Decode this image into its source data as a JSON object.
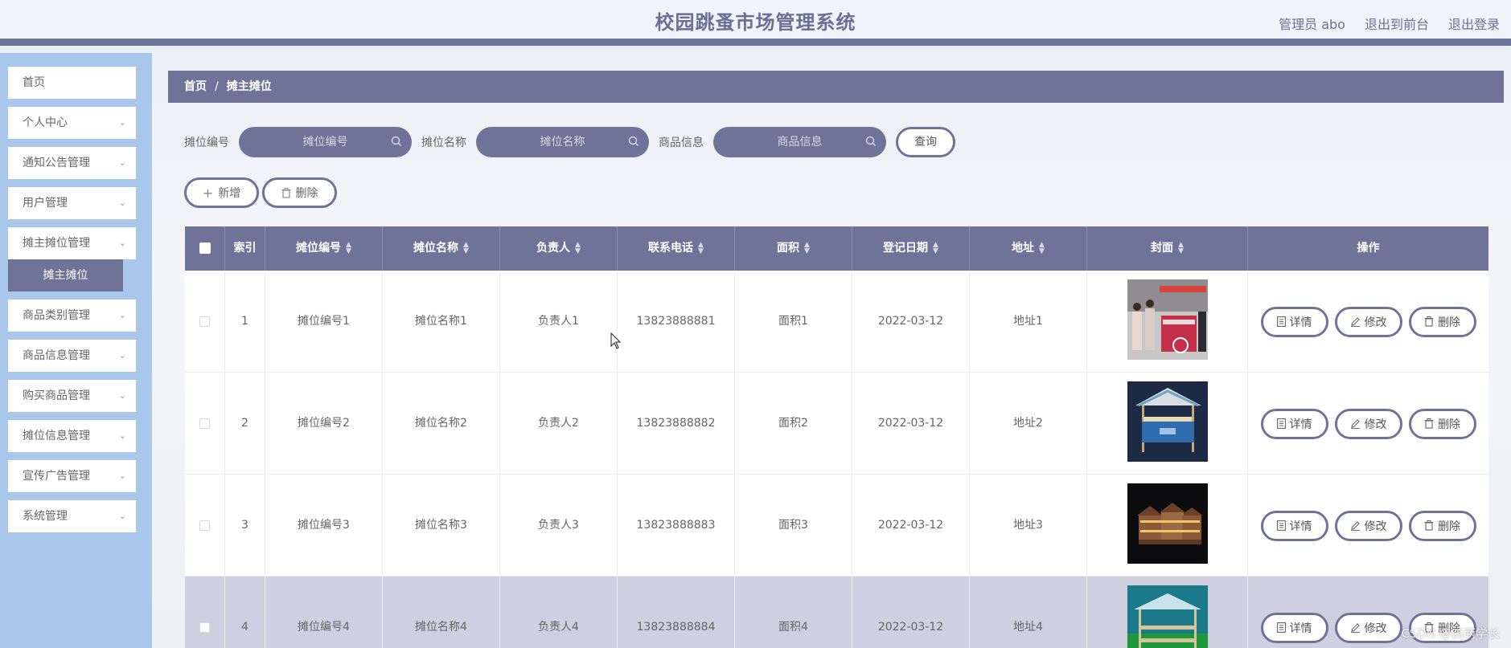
{
  "header": {
    "title": "校园跳蚤市场管理系统",
    "admin_label": "管理员 abo",
    "front_label": "退出到前台",
    "logout_label": "退出登录"
  },
  "sidebar": {
    "items": [
      {
        "label": "首页",
        "expandable": false
      },
      {
        "label": "个人中心",
        "expandable": true
      },
      {
        "label": "通知公告管理",
        "expandable": true
      },
      {
        "label": "用户管理",
        "expandable": true
      },
      {
        "label": "摊主摊位管理",
        "expandable": true
      },
      {
        "label": "商品类别管理",
        "expandable": true
      },
      {
        "label": "商品信息管理",
        "expandable": true
      },
      {
        "label": "购买商品管理",
        "expandable": true
      },
      {
        "label": "摊位信息管理",
        "expandable": true
      },
      {
        "label": "宣传广告管理",
        "expandable": true
      },
      {
        "label": "系统管理",
        "expandable": true
      }
    ],
    "active_sub": "摊主摊位"
  },
  "breadcrumb": {
    "home": "首页",
    "sep": "/",
    "current": "摊主摊位"
  },
  "search": {
    "fields": [
      {
        "label": "摊位编号",
        "placeholder": "摊位编号"
      },
      {
        "label": "摊位名称",
        "placeholder": "摊位名称"
      },
      {
        "label": "商品信息",
        "placeholder": "商品信息"
      }
    ],
    "query_label": "查询"
  },
  "actions": {
    "add_label": "新增",
    "delete_label": "删除"
  },
  "table": {
    "headers": [
      "索引",
      "摊位编号",
      "摊位名称",
      "负责人",
      "联系电话",
      "面积",
      "登记日期",
      "地址",
      "封面",
      "操作"
    ],
    "rows": [
      {
        "index": "1",
        "code": "摊位编号1",
        "name": "摊位名称1",
        "owner": "负责人1",
        "phone": "13823888881",
        "area": "面积1",
        "date": "2022-03-12",
        "address": "地址1"
      },
      {
        "index": "2",
        "code": "摊位编号2",
        "name": "摊位名称2",
        "owner": "负责人2",
        "phone": "13823888882",
        "area": "面积2",
        "date": "2022-03-12",
        "address": "地址2"
      },
      {
        "index": "3",
        "code": "摊位编号3",
        "name": "摊位名称3",
        "owner": "负责人3",
        "phone": "13823888883",
        "area": "面积3",
        "date": "2022-03-12",
        "address": "地址3"
      },
      {
        "index": "4",
        "code": "摊位编号4",
        "name": "摊位名称4",
        "owner": "负责人4",
        "phone": "13823888884",
        "area": "面积4",
        "date": "2022-03-12",
        "address": "地址4"
      }
    ],
    "row_ops": {
      "detail": "详情",
      "edit": "修改",
      "delete": "删除"
    }
  },
  "colors": {
    "primary": "#6f7398",
    "sidebar": "#a9c7ea",
    "header_bg": "#edf5fb"
  },
  "watermark": "CSDN @四两学长"
}
